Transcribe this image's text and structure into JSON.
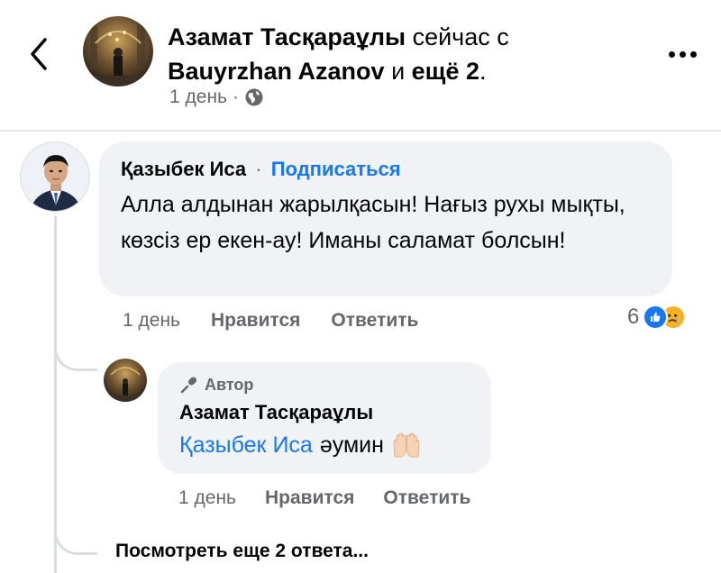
{
  "header": {
    "author": "Азамат Тасқараұлы",
    "text1": " сейчас с ",
    "tagged": "Bauyrzhan Azanov",
    "text2": " и ",
    "others": "ещё 2",
    "text3": ".",
    "time": "1 день",
    "separator": "·"
  },
  "comment": {
    "author": "Қазыбек Иса",
    "dot": "·",
    "follow_label": "Подписаться",
    "text": "Алла алдынан жарылқасын! Нағыз рухы мықты, көзсіз ер екен-ау! Иманы саламат болсын!",
    "time": "1 день",
    "like_label": "Нравится",
    "reply_label": "Ответить",
    "reaction_count": "6"
  },
  "reply": {
    "badge": "Автор",
    "author": "Азамат Тасқараұлы",
    "mention": "Қазыбек Иса",
    "text": "әумин",
    "time": "1 день",
    "like_label": "Нравится",
    "reply_label": "Ответить"
  },
  "view_more_label": "Посмотреть еще 2 ответа..."
}
